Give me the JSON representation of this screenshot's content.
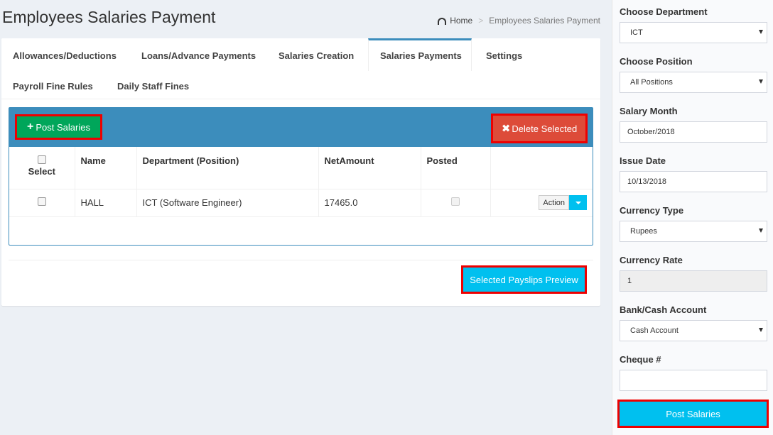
{
  "header": {
    "title": "Employees Salaries Payment",
    "breadcrumb": {
      "home": "Home",
      "current": "Employees Salaries Payment"
    }
  },
  "tabs": [
    {
      "label": "Allowances/Deductions"
    },
    {
      "label": "Loans/Advance Payments"
    },
    {
      "label": "Salaries Creation"
    },
    {
      "label": "Salaries Payments"
    },
    {
      "label": "Settings"
    },
    {
      "label": "Payroll Fine Rules"
    },
    {
      "label": "Daily Staff Fines"
    }
  ],
  "active_tab": "Salaries Payments",
  "toolbar": {
    "post_label": "Post Salaries",
    "delete_label": "Delete Selected"
  },
  "table": {
    "columns": [
      "Select",
      "Name",
      "Department (Position)",
      "NetAmount",
      "Posted",
      ""
    ],
    "rows": [
      {
        "name": "HALL",
        "department": "ICT (Software Engineer)",
        "net_amount": "17465.0",
        "action": "Action"
      }
    ]
  },
  "preview_label": "Selected Payslips Preview",
  "sidebar": {
    "department": {
      "label": "Choose Department",
      "value": "ICT"
    },
    "position": {
      "label": "Choose Position",
      "value": "All Positions"
    },
    "salary_month": {
      "label": "Salary Month",
      "value": "October/2018"
    },
    "issue_date": {
      "label": "Issue Date",
      "value": "10/13/2018"
    },
    "currency_type": {
      "label": "Currency Type",
      "value": "Rupees"
    },
    "currency_rate": {
      "label": "Currency Rate",
      "value": "1"
    },
    "bank_account": {
      "label": "Bank/Cash Account",
      "value": "Cash Account"
    },
    "cheque": {
      "label": "Cheque #",
      "value": ""
    },
    "post_label": "Post Salaries"
  },
  "colors": {
    "primary": "#3c8dbc",
    "success": "#00a65a",
    "danger": "#dd4b39",
    "info": "#00c0ef",
    "highlight_border": "#ee0000"
  }
}
